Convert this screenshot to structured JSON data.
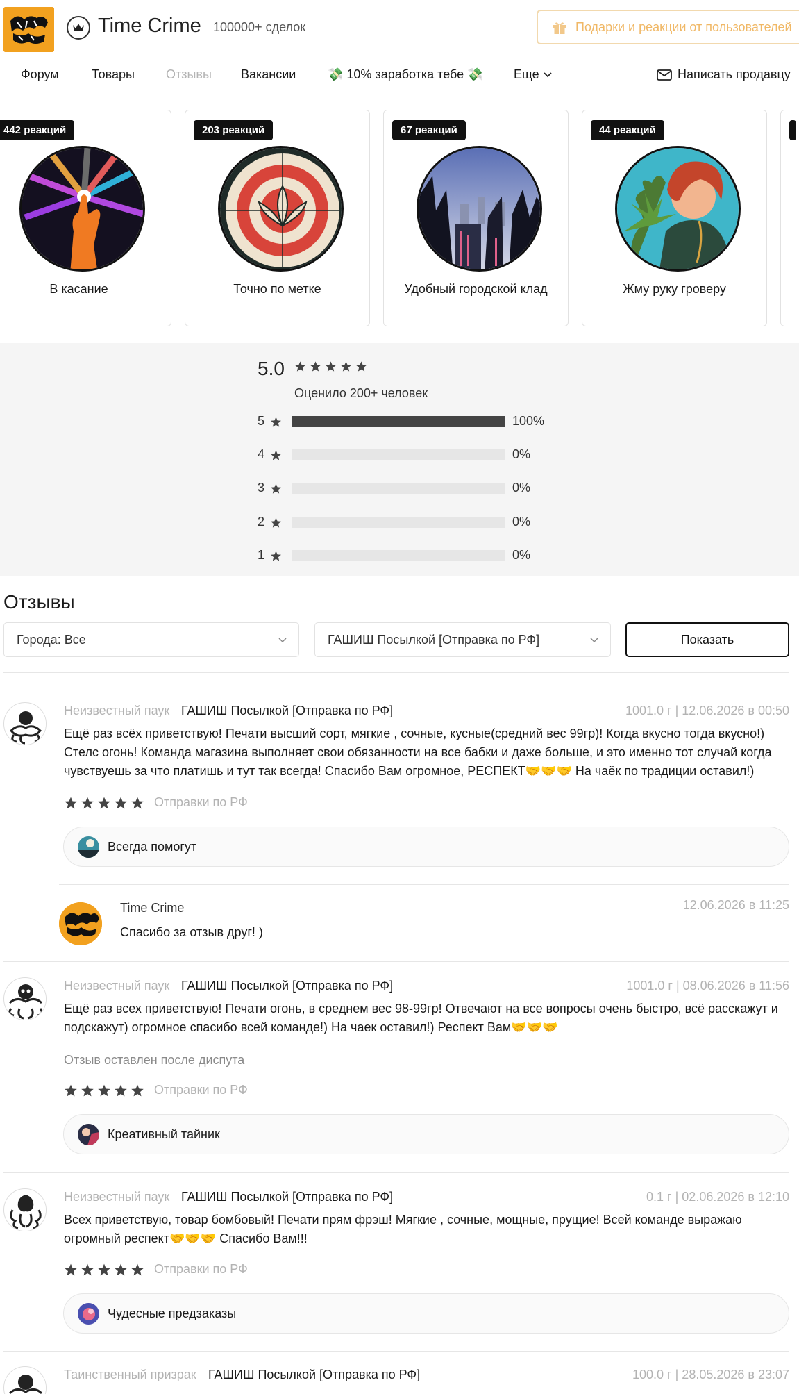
{
  "header": {
    "shop_name": "Time Crime",
    "deals": "100000+ сделок",
    "gift_button": "Подарки и реакции от пользователей",
    "nav": [
      "Форум",
      "Товары",
      "Отзывы",
      "Вакансии",
      "💸 10% заработка тебе 💸",
      "Еще"
    ],
    "active_nav": "Отзывы",
    "write_seller": "Написать продавцу"
  },
  "cards": [
    {
      "reactions": "442 реакций",
      "title": "В касание"
    },
    {
      "reactions": "203 реакций",
      "title": "Точно по метке"
    },
    {
      "reactions": "67 реакций",
      "title": "Удобный городской клад"
    },
    {
      "reactions": "44 реакций",
      "title": "Жму руку гроверу"
    }
  ],
  "rating": {
    "score": "5.0",
    "rated_by": "Оценило 200+ человек",
    "rows": [
      {
        "stars": "5",
        "percent": "100%",
        "fraction": 1.0
      },
      {
        "stars": "4",
        "percent": "0%",
        "fraction": 0
      },
      {
        "stars": "3",
        "percent": "0%",
        "fraction": 0
      },
      {
        "stars": "2",
        "percent": "0%",
        "fraction": 0
      },
      {
        "stars": "1",
        "percent": "0%",
        "fraction": 0
      }
    ]
  },
  "reviews_section": {
    "title": "Отзывы",
    "city_filter": "Города: Все",
    "product_filter": "ГАШИШ Посылкой [Отправка по РФ]",
    "show_button": "Показать"
  },
  "reviews": [
    {
      "author": "Неизвестный паук",
      "product": "ГАШИШ Посылкой [Отправка по РФ]",
      "date": "1001.0 г | 12.06.2026 в 00:50",
      "text": "Ещё раз всёх приветствую! Печати высший сорт, мягкие , сочные, кусные(средний вес 99гр)! Когда вкусно тогда вкусно!) Стелс огонь! Команда магазина выполняет свои обязанности на все бабки и даже больше, и это именно тот случай когда чувствуешь за что платишь и тут так всегда! Спасибо Вам огромное, РЕСПЕКТ🤝🤝🤝 На чаёк по традиции оставил!)",
      "note": "",
      "shipping": "Отправки по РФ",
      "tag": "Всегда помогут",
      "reply": {
        "author": "Time Crime",
        "date": "12.06.2026 в 11:25",
        "text": "Спасибо за отзыв друг! )"
      }
    },
    {
      "author": "Неизвестный паук",
      "product": "ГАШИШ Посылкой [Отправка по РФ]",
      "date": "1001.0 г | 08.06.2026 в 11:56",
      "text": "Ещё раз всех приветствую! Печати огонь, в среднем вес 98-99гр! Отвечают на все вопросы очень быстро, всё расскажут и подскажут) огромное спасибо всей команде!) На чаек оставил!) Респект Вам🤝🤝🤝",
      "note": "Отзыв оставлен после диспута",
      "shipping": "Отправки по РФ",
      "tag": "Креативный тайник"
    },
    {
      "author": "Неизвестный паук",
      "product": "ГАШИШ Посылкой [Отправка по РФ]",
      "date": "0.1 г | 02.06.2026 в 12:10",
      "text": "Всех приветствую, товар бомбовый! Печати прям фрэш! Мягкие , сочные, мощные, прущие! Всей команде выражаю огромный респект🤝🤝🤝 Спасибо Вам!!!",
      "note": "",
      "shipping": "Отправки по РФ",
      "tag": "Чудесные предзаказы"
    },
    {
      "author": "Таинственный призрак",
      "product": "ГАШИШ Посылкой [Отправка по РФ]",
      "date": "100.0 г | 28.05.2026 в 23:07"
    }
  ],
  "colors": {
    "brand": "#f2a11f",
    "gift_text": "#f0b866",
    "muted": "#b3b3b3",
    "bar": "#444444"
  }
}
